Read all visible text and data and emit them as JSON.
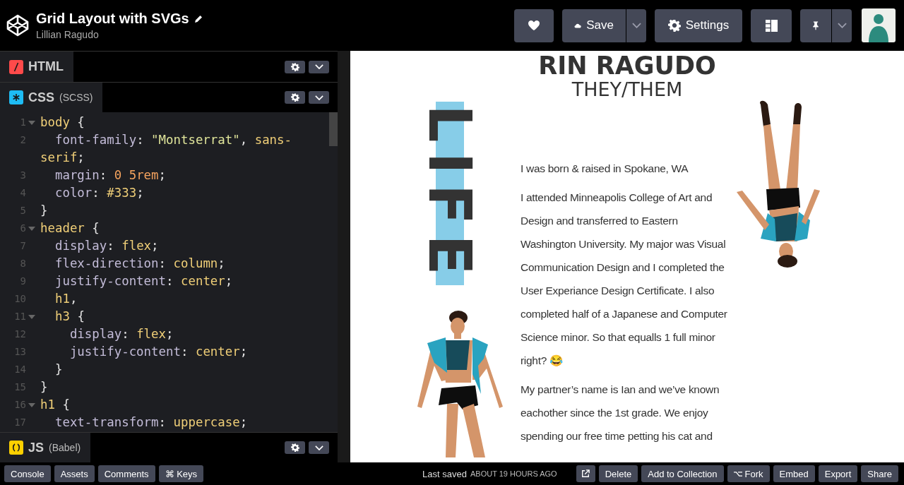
{
  "header": {
    "title": "Grid Layout with SVGs",
    "author": "Lillian Ragudo"
  },
  "toolbar": {
    "save_label": "Save",
    "settings_label": "Settings"
  },
  "editors": [
    {
      "kind": "html",
      "label": "HTML"
    },
    {
      "kind": "css",
      "label": "CSS",
      "preprocessor": "(SCSS)",
      "code": [
        {
          "number": "1",
          "fold": true,
          "tokens": [
            {
              "text": "body",
              "kind": "selector"
            },
            {
              "text": " {",
              "kind": "punct"
            }
          ]
        },
        {
          "number": "2",
          "fold": false,
          "tokens": [
            {
              "text": "  font-family",
              "kind": "property"
            },
            {
              "text": ": ",
              "kind": "punct"
            },
            {
              "text": "\"Montserrat\"",
              "kind": "string"
            },
            {
              "text": ", ",
              "kind": "punct"
            },
            {
              "text": "sans-serif",
              "kind": "value"
            },
            {
              "text": ";",
              "kind": "punct"
            }
          ]
        },
        {
          "number": "3",
          "fold": false,
          "tokens": [
            {
              "text": "  margin",
              "kind": "property"
            },
            {
              "text": ": ",
              "kind": "punct"
            },
            {
              "text": "0 5rem",
              "kind": "number"
            },
            {
              "text": ";",
              "kind": "punct"
            }
          ]
        },
        {
          "number": "4",
          "fold": false,
          "tokens": [
            {
              "text": "  color",
              "kind": "property"
            },
            {
              "text": ": ",
              "kind": "punct"
            },
            {
              "text": "#333",
              "kind": "value"
            },
            {
              "text": ";",
              "kind": "punct"
            }
          ]
        },
        {
          "number": "5",
          "fold": false,
          "tokens": [
            {
              "text": "}",
              "kind": "punct"
            }
          ]
        },
        {
          "number": "6",
          "fold": true,
          "tokens": [
            {
              "text": "header",
              "kind": "selector"
            },
            {
              "text": " {",
              "kind": "punct"
            }
          ]
        },
        {
          "number": "7",
          "fold": false,
          "tokens": [
            {
              "text": "  display",
              "kind": "property"
            },
            {
              "text": ": ",
              "kind": "punct"
            },
            {
              "text": "flex",
              "kind": "value"
            },
            {
              "text": ";",
              "kind": "punct"
            }
          ]
        },
        {
          "number": "8",
          "fold": false,
          "tokens": [
            {
              "text": "  flex-direction",
              "kind": "property"
            },
            {
              "text": ": ",
              "kind": "punct"
            },
            {
              "text": "column",
              "kind": "value"
            },
            {
              "text": ";",
              "kind": "punct"
            }
          ]
        },
        {
          "number": "9",
          "fold": false,
          "tokens": [
            {
              "text": "  justify-content",
              "kind": "property"
            },
            {
              "text": ": ",
              "kind": "punct"
            },
            {
              "text": "center",
              "kind": "value"
            },
            {
              "text": ";",
              "kind": "punct"
            }
          ]
        },
        {
          "number": "10",
          "fold": false,
          "tokens": [
            {
              "text": "  h1",
              "kind": "selector"
            },
            {
              "text": ",",
              "kind": "punct"
            }
          ]
        },
        {
          "number": "11",
          "fold": true,
          "tokens": [
            {
              "text": "  h3",
              "kind": "selector"
            },
            {
              "text": " {",
              "kind": "punct"
            }
          ]
        },
        {
          "number": "12",
          "fold": false,
          "tokens": [
            {
              "text": "    display",
              "kind": "property"
            },
            {
              "text": ": ",
              "kind": "punct"
            },
            {
              "text": "flex",
              "kind": "value"
            },
            {
              "text": ";",
              "kind": "punct"
            }
          ]
        },
        {
          "number": "13",
          "fold": false,
          "tokens": [
            {
              "text": "    justify-content",
              "kind": "property"
            },
            {
              "text": ": ",
              "kind": "punct"
            },
            {
              "text": "center",
              "kind": "value"
            },
            {
              "text": ";",
              "kind": "punct"
            }
          ]
        },
        {
          "number": "14",
          "fold": false,
          "tokens": [
            {
              "text": "  }",
              "kind": "punct"
            }
          ]
        },
        {
          "number": "15",
          "fold": false,
          "tokens": [
            {
              "text": "}",
              "kind": "punct"
            }
          ]
        },
        {
          "number": "16",
          "fold": true,
          "tokens": [
            {
              "text": "h1",
              "kind": "selector"
            },
            {
              "text": " {",
              "kind": "punct"
            }
          ]
        },
        {
          "number": "17",
          "fold": false,
          "tokens": [
            {
              "text": "  text-transform",
              "kind": "property"
            },
            {
              "text": ": ",
              "kind": "punct"
            },
            {
              "text": "uppercase",
              "kind": "value"
            },
            {
              "text": ";",
              "kind": "punct"
            }
          ]
        }
      ]
    },
    {
      "kind": "js",
      "label": "JS",
      "preprocessor": "(Babel)"
    }
  ],
  "preview": {
    "name": "RIN RAGUDO",
    "pronouns": "THEY/THEM",
    "banner_word": "LIFE",
    "paragraphs": [
      "I was born & raised in Spokane, WA",
      "I attended Minneapolis College of Art and Design and transferred to Eastern Washington University. My major was Visual Communication Design and I completed the User Experiance Design Certificate. I also completed half of a Japanese and Computer Science minor. So that equalls 1 full minor right? 😂",
      "My partner’s name is Ian and we’ve known eachother since the 1st grade. We enjoy spending our free time petting his cat and"
    ]
  },
  "footer": {
    "left_buttons": [
      "Console",
      "Assets",
      "Comments",
      "⌘ Keys"
    ],
    "saved_label": "Last saved",
    "saved_time": "ABOUT 19 HOURS AGO",
    "right_buttons": [
      {
        "kind": "external"
      },
      {
        "kind": "text",
        "label": "Delete"
      },
      {
        "kind": "text",
        "label": "Add to Collection"
      },
      {
        "kind": "fork",
        "label": "Fork"
      },
      {
        "kind": "text",
        "label": "Embed"
      },
      {
        "kind": "text",
        "label": "Export"
      },
      {
        "kind": "text",
        "label": "Share"
      }
    ]
  }
}
